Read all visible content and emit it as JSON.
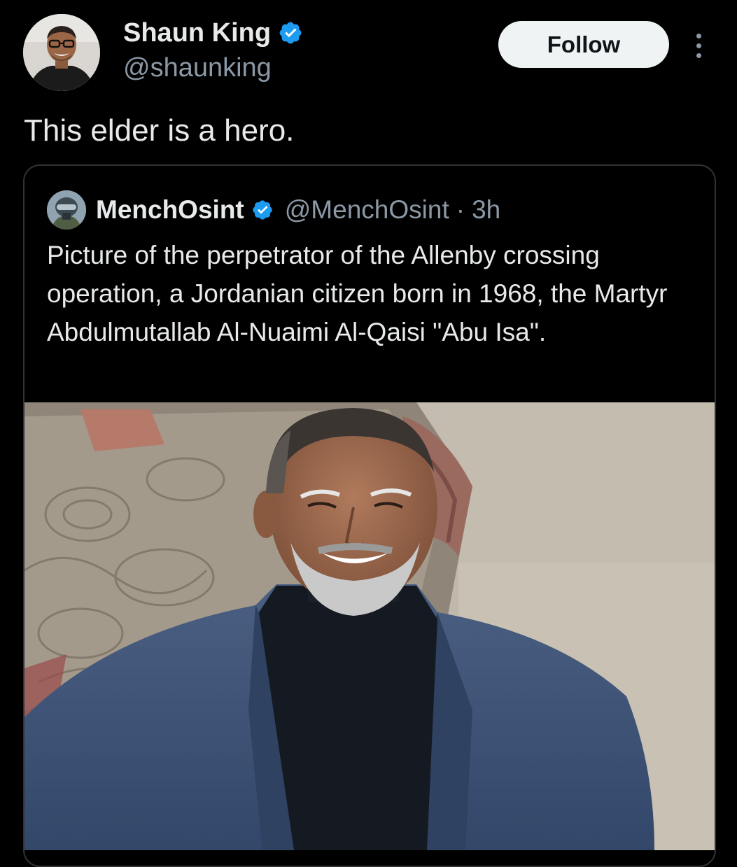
{
  "tweet": {
    "author": {
      "name": "Shaun King",
      "handle": "@shaunking",
      "verified": true
    },
    "follow_label": "Follow",
    "more_icon": "more-vertical-icon",
    "text": "This elder is a hero."
  },
  "quoted_tweet": {
    "author": {
      "name": "MenchOsint",
      "handle": "@MenchOsint",
      "verified": true
    },
    "separator": "·",
    "time": "3h",
    "text": "Picture of the perpetrator of the Allenby crossing operation, a Jordanian citizen born in 1968, the Martyr Abdulmutallab Al-Nuaimi Al-Qaisi \"Abu Isa\"."
  },
  "colors": {
    "background": "#000000",
    "primary_text": "#e7e9ea",
    "secondary_text": "#8b98a5",
    "verified_blue": "#1d9bf0",
    "follow_button_bg": "#eff3f4",
    "border": "#2f3336"
  }
}
